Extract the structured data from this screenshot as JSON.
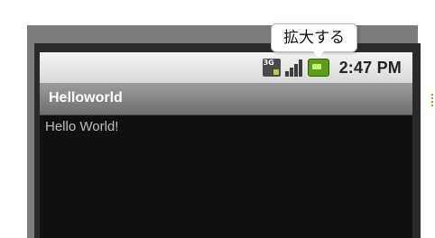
{
  "status_bar": {
    "time": "2:47 PM",
    "icons": [
      "3g-data-icon",
      "signal-strength-icon",
      "battery-charging-icon"
    ]
  },
  "app": {
    "title": "Helloworld"
  },
  "content": {
    "text": "Hello World!"
  },
  "tooltip": {
    "label": "拡大する"
  },
  "colors": {
    "status_bar": "#e6e6e6",
    "title_bar": "#868686",
    "screen_bg": "#111111",
    "content_text": "#bdbdbd",
    "battery": "#5c9e1a"
  }
}
